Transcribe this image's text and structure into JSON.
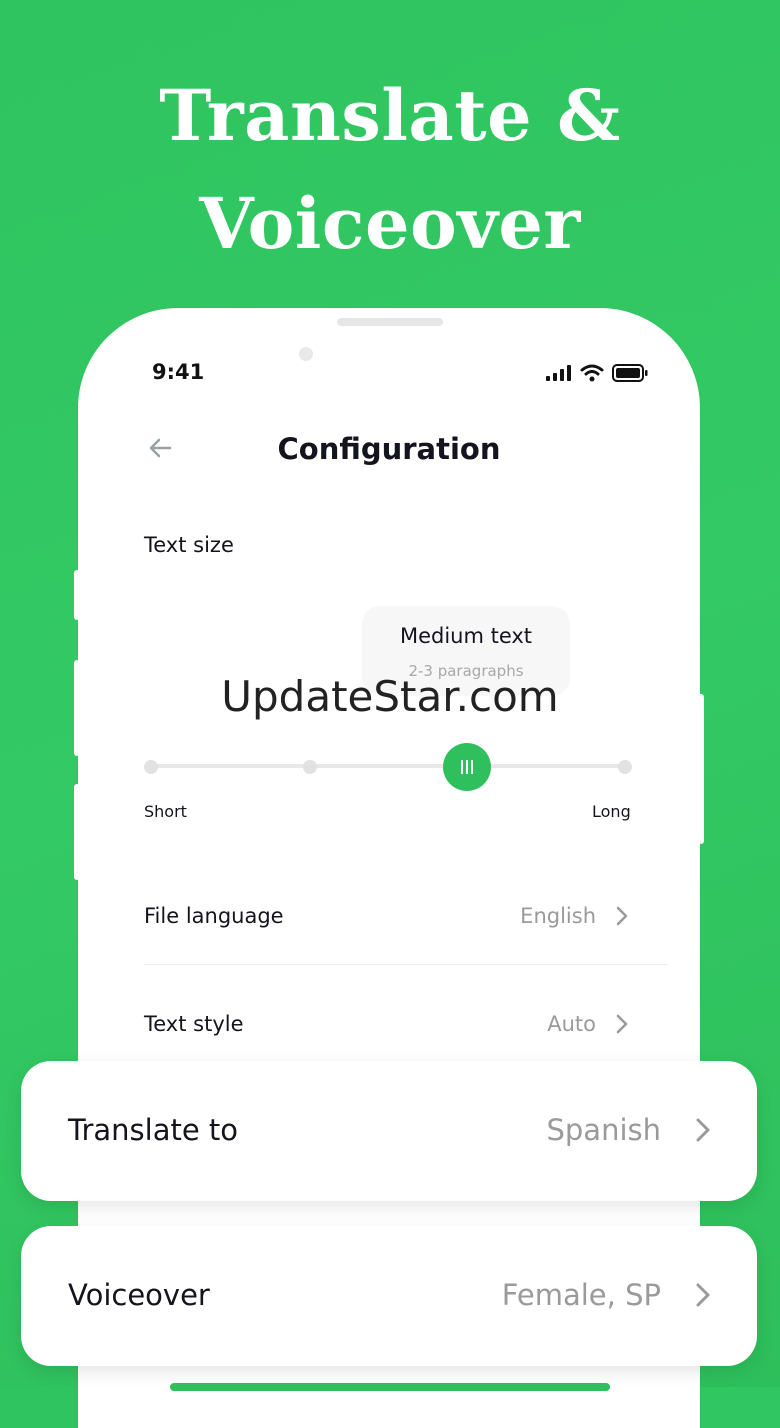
{
  "hero": {
    "line1": "Translate &",
    "line2": "Voiceover"
  },
  "status_bar": {
    "time": "9:41",
    "icons": [
      "signal-icon",
      "wifi-icon",
      "battery-icon"
    ]
  },
  "nav": {
    "title": "Configuration",
    "back_icon": "arrow-left-icon"
  },
  "text_size": {
    "label": "Text size",
    "tooltip_title": "Medium text",
    "tooltip_subtitle": "2-3 paragraphs",
    "slider_min_label": "Short",
    "slider_max_label": "Long",
    "slider_steps": 4,
    "slider_selected_index": 2
  },
  "rows": [
    {
      "label": "File language",
      "value": "English"
    },
    {
      "label": "Text style",
      "value": "Auto"
    }
  ],
  "cards": [
    {
      "label": "Translate to",
      "value": "Spanish"
    },
    {
      "label": "Voiceover",
      "value": "Female, SP"
    }
  ],
  "watermark": "UpdateStar.com",
  "colors": {
    "background": "#33c964",
    "accent": "#2fbf5c",
    "text": "#14141e",
    "muted": "#9a9a9a"
  }
}
